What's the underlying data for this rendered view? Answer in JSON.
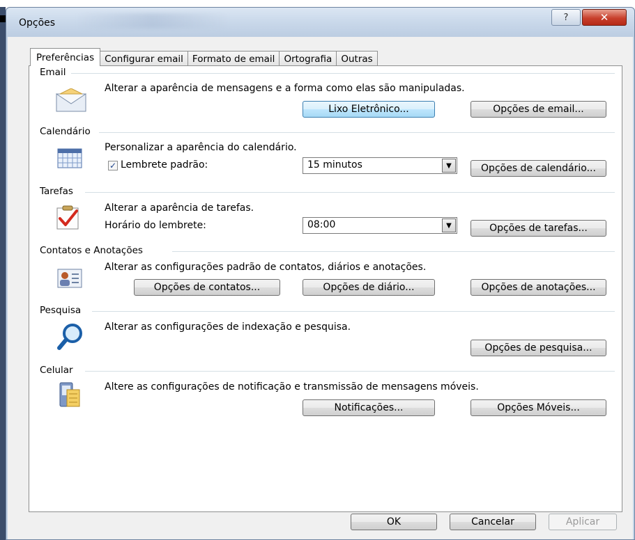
{
  "window": {
    "title": "Opções",
    "help_glyph": "?",
    "close_glyph": "✕"
  },
  "tabs": [
    "Preferências",
    "Configurar email",
    "Formato de email",
    "Ortografia",
    "Outras"
  ],
  "sections": {
    "email": {
      "label": "Email",
      "description": "Alterar a aparência de mensagens e a forma como elas são manipuladas.",
      "buttons": [
        "Lixo Eletrônico...",
        "Opções de email..."
      ]
    },
    "calendario": {
      "label": "Calendário",
      "description": "Personalizar a aparência do calendário.",
      "checkbox_label": "Lembrete padrão:",
      "checkbox_checked": true,
      "select_value": "15 minutos",
      "button": "Opções de calendário..."
    },
    "tarefas": {
      "label": "Tarefas",
      "description": "Alterar a aparência de tarefas.",
      "field_label": "Horário do lembrete:",
      "select_value": "08:00",
      "button": "Opções de tarefas..."
    },
    "contatos": {
      "label": "Contatos e Anotações",
      "description": "Alterar as configurações padrão de contatos, diários e anotações.",
      "buttons": [
        "Opções de contatos...",
        "Opções de diário...",
        "Opções de anotações..."
      ]
    },
    "pesquisa": {
      "label": "Pesquisa",
      "description": "Alterar as configurações de indexação e pesquisa.",
      "button": "Opções de pesquisa..."
    },
    "celular": {
      "label": "Celular",
      "description": "Altere as configurações de notificação e transmissão de mensagens móveis.",
      "buttons": [
        "Notificações...",
        "Opções Móveis..."
      ]
    }
  },
  "footer": {
    "ok": "OK",
    "cancel": "Cancelar",
    "apply": "Aplicar"
  }
}
